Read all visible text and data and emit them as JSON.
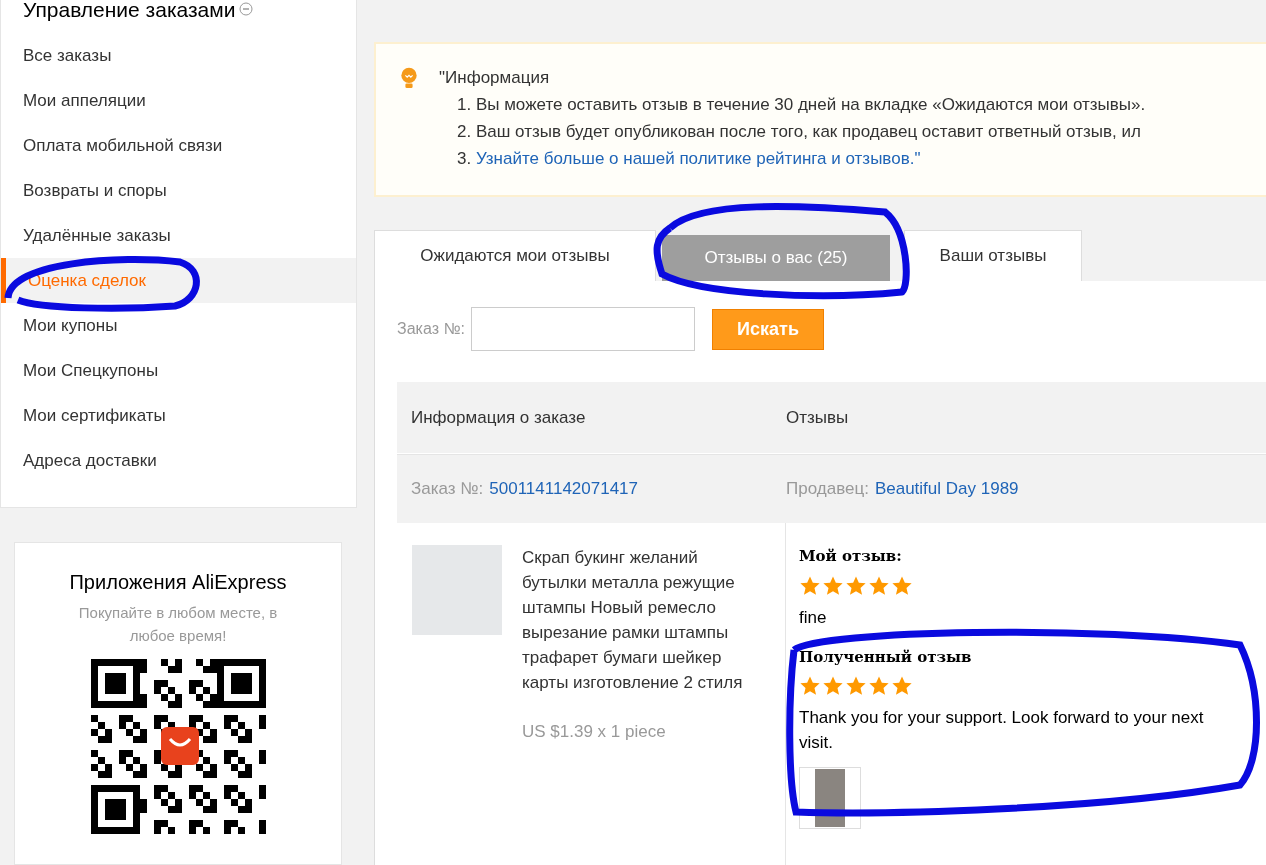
{
  "sidebar": {
    "title": "Управление заказами",
    "items": [
      {
        "label": "Все заказы",
        "selected": false
      },
      {
        "label": "Мои аппеляции",
        "selected": false
      },
      {
        "label": "Оплата мобильной связи",
        "selected": false
      },
      {
        "label": "Возвраты и споры",
        "selected": false
      },
      {
        "label": "Удалённые заказы",
        "selected": false
      },
      {
        "label": "Оценка сделок",
        "selected": true
      },
      {
        "label": "Мои купоны",
        "selected": false
      },
      {
        "label": "Мои Спецкупоны",
        "selected": false
      },
      {
        "label": "Мои сертификаты",
        "selected": false
      },
      {
        "label": "Адреса доставки",
        "selected": false
      }
    ]
  },
  "app_promo": {
    "title": "Приложения AliExpress",
    "subtitle": "Покупайте в любом месте, в любое время!"
  },
  "info": {
    "heading": "\"Информация",
    "lines": [
      "1. Вы можете оставить отзыв в течение 30 дней на вкладке «Ожидаются мои отзывы».",
      "2. Ваш отзыв будет опубликован после того, как продавец оставит ответный отзыв, ил"
    ],
    "link_prefix": "3. ",
    "link": "Узнайте больше о нашей политике рейтинга и отзывов.\""
  },
  "tabs": [
    {
      "label": "Ожидаются мои отзывы",
      "selected": false
    },
    {
      "label": "Отзывы о вас (25)",
      "selected": true
    },
    {
      "label": "Ваши отзывы",
      "selected": false
    }
  ],
  "search": {
    "label": "Заказ №:",
    "button": "Искать"
  },
  "table": {
    "columns": [
      "Информация о заказе",
      "Отзывы"
    ],
    "order": {
      "order_label": "Заказ №:",
      "order_number": "5001141142071417",
      "seller_label": "Продавец:",
      "seller": "Beautiful Day 1989"
    },
    "product": {
      "title": "Скрап букинг желаний бутылки металла режущие штампы Новый ремесло вырезание рамки штампы трафарет бумаги шейкер карты изготовление 2 стиля",
      "price": "US $1.39 x 1 piece"
    },
    "reviews": [
      {
        "heading": "Мой отзыв:",
        "stars": 5,
        "text": "fine",
        "has_photo": false
      },
      {
        "heading": "Полученный отзыв",
        "stars": 5,
        "text": "Thank you for your support. Look forward to your next visit.",
        "has_photo": true
      }
    ]
  }
}
